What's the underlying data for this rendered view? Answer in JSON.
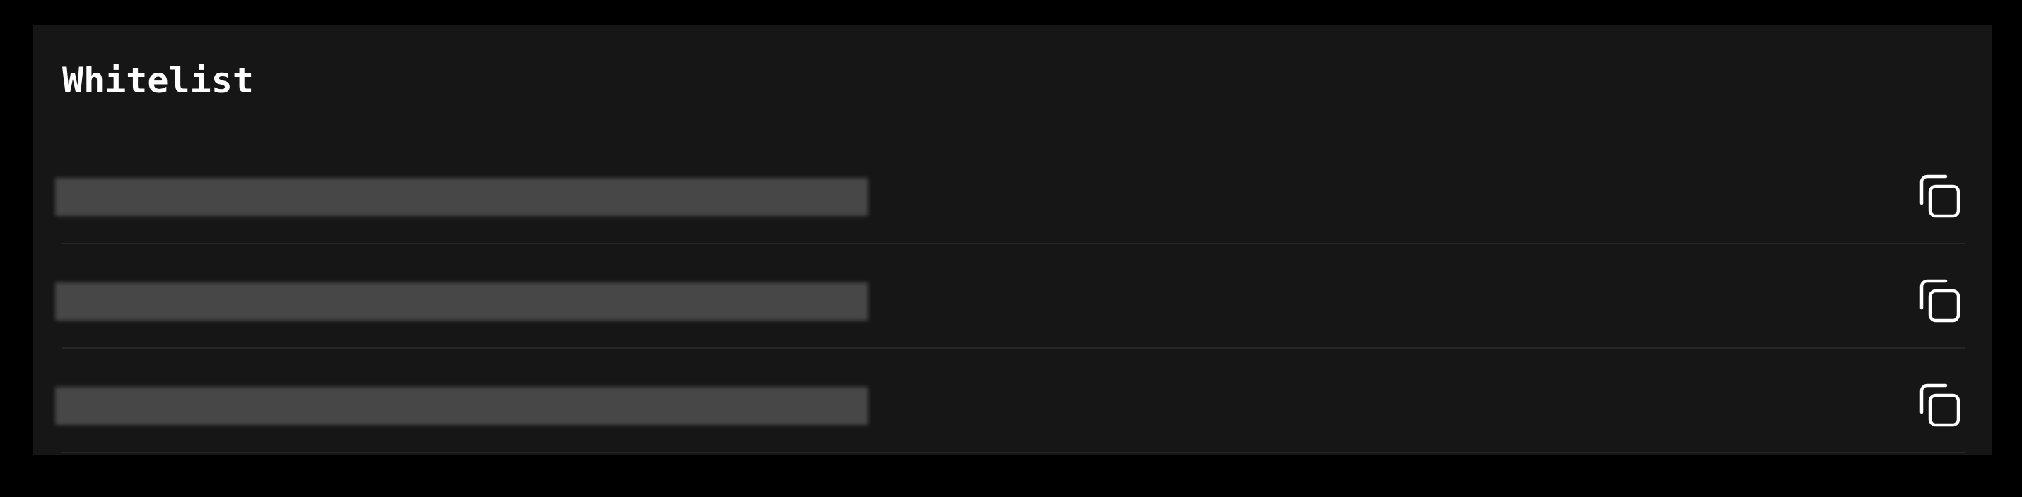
{
  "panel": {
    "title": "Whitelist"
  },
  "whitelist": {
    "items": [
      {
        "value": "",
        "copy_icon": "copy-icon"
      },
      {
        "value": "",
        "copy_icon": "copy-icon"
      },
      {
        "value": "",
        "copy_icon": "copy-icon"
      }
    ]
  },
  "colors": {
    "page_background": "#000000",
    "panel_background": "#161616",
    "redacted_bar": "#474747",
    "divider": "#262626",
    "text": "#ffffff"
  }
}
